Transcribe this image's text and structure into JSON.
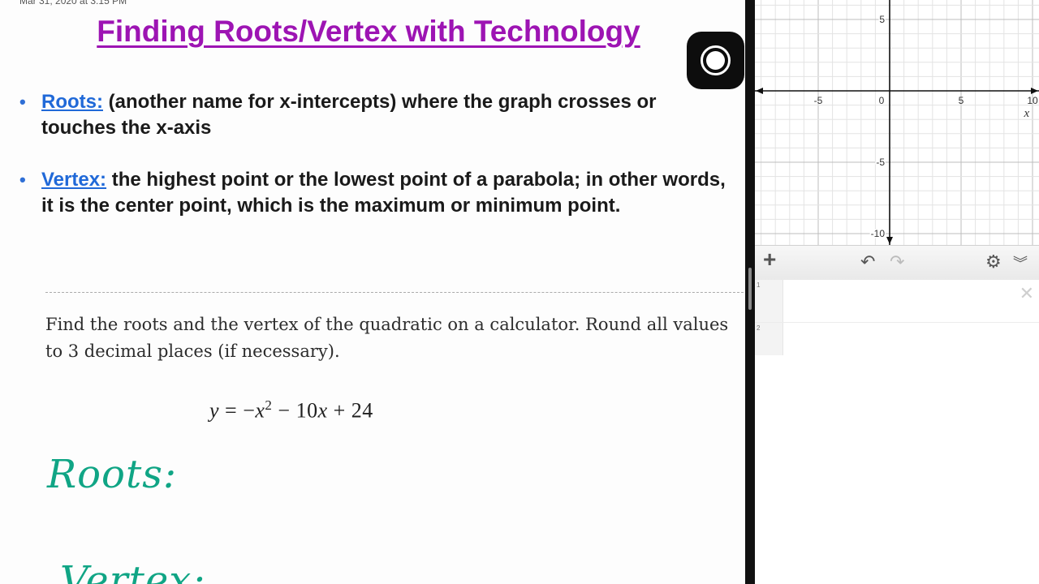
{
  "notes": {
    "timestamp": "Mar 31, 2020 at 3:15 PM",
    "title": "Finding Roots/Vertex with Technology",
    "bullets": [
      {
        "term": "Roots:",
        "text": " (another name for x-intercepts) where the graph crosses or touches the x-axis"
      },
      {
        "term": "Vertex:",
        "text": "  the highest point or the lowest point of a parabola; in other words, it is the center point, which is the maximum or minimum point."
      }
    ],
    "problem": "Find the roots and the vertex of the quadratic on a calculator. Round all values to 3 decimal places (if necessary).",
    "equation": {
      "lhs": "y",
      "eq": " = −",
      "x1": "x",
      "exp": "2",
      "mid": " − 10",
      "x2": "x",
      "tail": " + 24"
    },
    "handwritten": {
      "roots": "Roots:",
      "vertex": "Vertex:"
    },
    "colors": {
      "title": "#9d14b3",
      "term": "#2069d8",
      "handwriting": "#10a585"
    }
  },
  "record_button": {
    "icon": "record-icon"
  },
  "graph": {
    "x_axis_label": "x",
    "x_ticks": [
      "-5",
      "0",
      "5",
      "10"
    ],
    "y_ticks": [
      "5",
      "-5",
      "-10"
    ],
    "x_range": [
      -11,
      11
    ],
    "y_range": [
      -11,
      6
    ],
    "grid": true
  },
  "toolbar": {
    "add_icon": "plus-icon",
    "undo_icon": "undo-icon",
    "redo_icon": "redo-icon",
    "settings_icon": "gear-icon",
    "collapse_icon": "double-chevron-down-icon",
    "add_label": "+",
    "undo_label": "↶",
    "redo_label": "↷",
    "settings_label": "⚙",
    "collapse_label": "︾"
  },
  "expressions": [
    {
      "number": "1",
      "value": "",
      "delete_label": "✕"
    },
    {
      "number": "2",
      "value": ""
    }
  ]
}
